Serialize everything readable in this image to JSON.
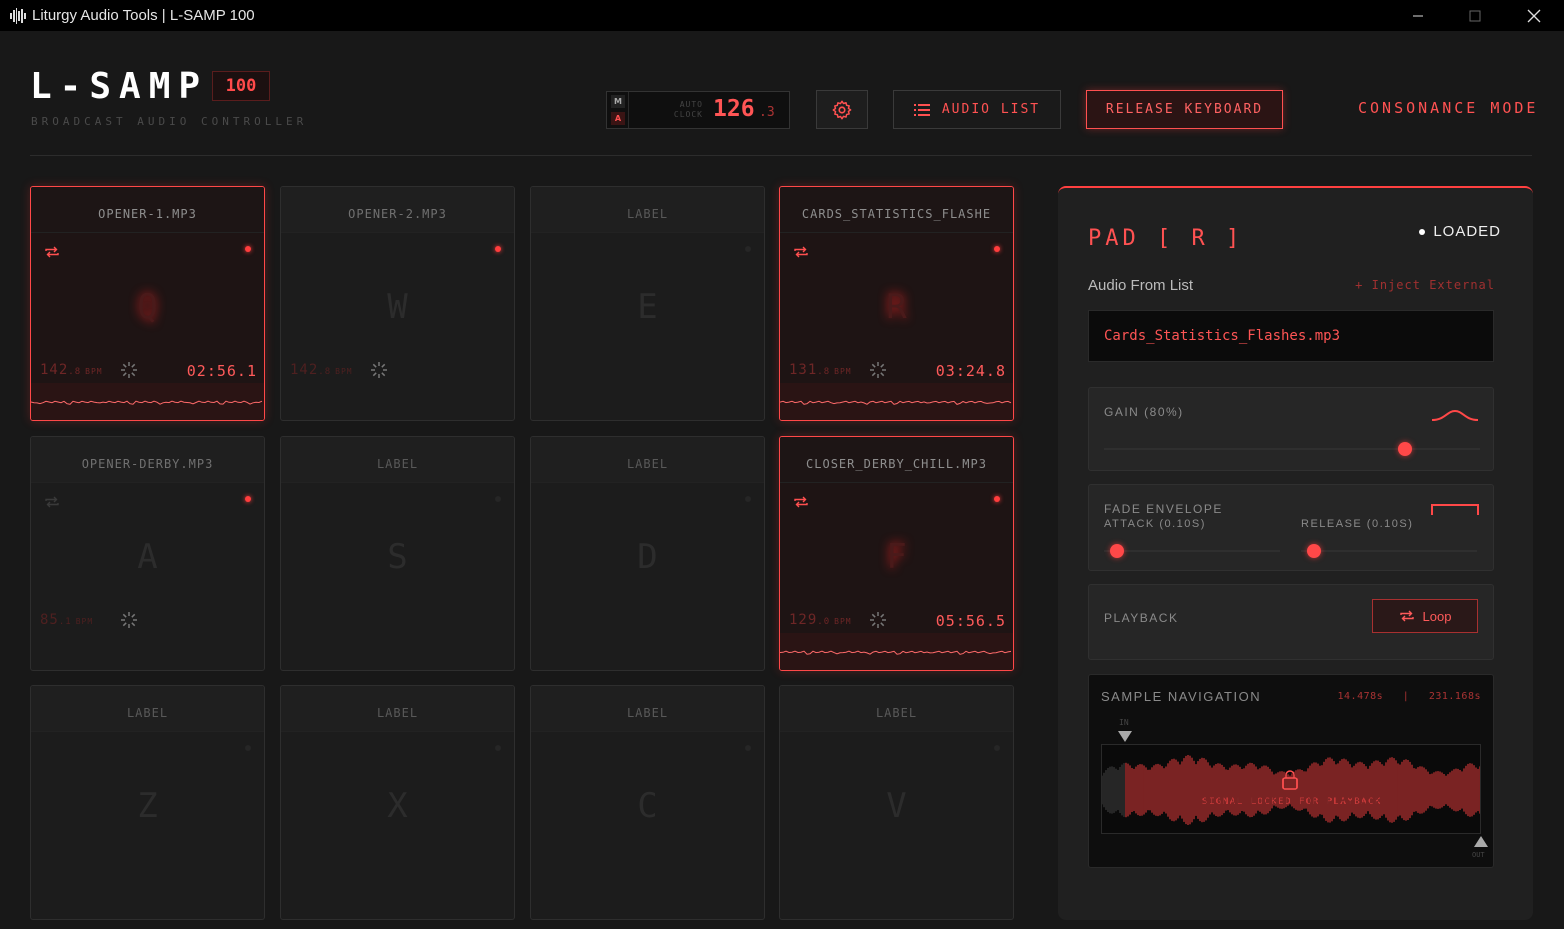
{
  "window": {
    "title": "Liturgy Audio Tools | L-SAMP 100"
  },
  "header": {
    "logo": "L-SAMP",
    "version_badge": "100",
    "subtitle": "BROADCAST AUDIO CONTROLLER",
    "clock": {
      "m_label": "M",
      "a_label": "A",
      "label_line1": "AUTO",
      "label_line2": "CLOCK",
      "bpm_int": "126",
      "bpm_dec": ".3"
    },
    "audio_list_label": "AUDIO LIST",
    "release_keyboard_label": "RELEASE KEYBOARD",
    "mode_label": "CONSONANCE MODE"
  },
  "pads": [
    {
      "name": "OPENER-1.MP3",
      "key": "Q",
      "state": "active",
      "bpm_int": "142",
      "bpm_dec": ".8",
      "bpm_unit": "BPM",
      "time": "02:56.1",
      "loop": true
    },
    {
      "name": "OPENER-2.MP3",
      "key": "W",
      "state": "loaded",
      "bpm_int": "142",
      "bpm_dec": ".8",
      "bpm_unit": "BPM",
      "time": "",
      "loop": false
    },
    {
      "name": "LABEL",
      "key": "E",
      "state": "empty",
      "bpm_int": "",
      "bpm_dec": "",
      "bpm_unit": "",
      "time": "",
      "loop": false
    },
    {
      "name": "CARDS_STATISTICS_FLASHE",
      "key": "R",
      "state": "active",
      "bpm_int": "131",
      "bpm_dec": ".8",
      "bpm_unit": "BPM",
      "time": "03:24.8",
      "loop": true
    },
    {
      "name": "OPENER-DERBY.MP3",
      "key": "A",
      "state": "loaded",
      "bpm_int": "85",
      "bpm_dec": ".1",
      "bpm_unit": "BPM",
      "time": "",
      "loop": false
    },
    {
      "name": "LABEL",
      "key": "S",
      "state": "empty",
      "bpm_int": "",
      "bpm_dec": "",
      "bpm_unit": "",
      "time": "",
      "loop": false
    },
    {
      "name": "LABEL",
      "key": "D",
      "state": "empty",
      "bpm_int": "",
      "bpm_dec": "",
      "bpm_unit": "",
      "time": "",
      "loop": false
    },
    {
      "name": "CLOSER_DERBY_CHILL.MP3",
      "key": "F",
      "state": "active",
      "bpm_int": "129",
      "bpm_dec": ".0",
      "bpm_unit": "BPM",
      "time": "05:56.5",
      "loop": true
    },
    {
      "name": "LABEL",
      "key": "Z",
      "state": "empty",
      "bpm_int": "",
      "bpm_dec": "",
      "bpm_unit": "",
      "time": "",
      "loop": false
    },
    {
      "name": "LABEL",
      "key": "X",
      "state": "empty",
      "bpm_int": "",
      "bpm_dec": "",
      "bpm_unit": "",
      "time": "",
      "loop": false
    },
    {
      "name": "LABEL",
      "key": "C",
      "state": "empty",
      "bpm_int": "",
      "bpm_dec": "",
      "bpm_unit": "",
      "time": "",
      "loop": false
    },
    {
      "name": "LABEL",
      "key": "V",
      "state": "empty",
      "bpm_int": "",
      "bpm_dec": "",
      "bpm_unit": "",
      "time": "",
      "loop": false
    }
  ],
  "panel": {
    "title": "PAD [ R ]",
    "status": "LOADED",
    "audio_from_list": "Audio From List",
    "inject_external": "+ Inject External",
    "file": "Cards_Statistics_Flashes.mp3",
    "gain_label": "GAIN (80%)",
    "gain_value": 0.8,
    "fade_label": "FADE ENVELOPE",
    "attack_label": "ATTACK (0.10S)",
    "release_label": "RELEASE (0.10S)",
    "playback_label": "PLAYBACK",
    "loop_label": "Loop",
    "nav_label": "SAMPLE NAVIGATION",
    "nav_in_time": "14.478s",
    "nav_sep": "|",
    "nav_out_time": "231.168s",
    "in_label": "IN",
    "out_label": "OUT",
    "locked_label": "SIGNAL LOCKED FOR PLAYBACK"
  },
  "colors": {
    "accent": "#ff4848",
    "background": "#181818",
    "panel": "#202020"
  }
}
